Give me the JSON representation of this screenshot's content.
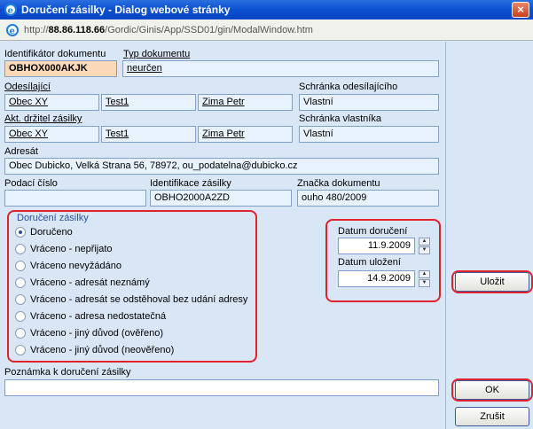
{
  "window": {
    "title": "Doručení zásilky - Dialog webové stránky",
    "close_label": "×"
  },
  "address": {
    "prefix": "http://",
    "host": "88.86.118.66",
    "path": "/Gordic/Ginis/App/SSD01/gin/ModalWindow.htm"
  },
  "fields": {
    "identifikator_label": "Identifikátor dokumentu",
    "identifikator_value": "OBHOX000AKJK",
    "typ_label": "Typ dokumentu",
    "typ_value": "neurčen",
    "odesilajici_label": "Odesílající",
    "odesilajici_values": [
      "Obec XY",
      "Test1",
      "Zima Petr"
    ],
    "schranka_odes_label": "Schránka odesílajícího",
    "schranka_odes_value": "Vlastní",
    "drzitel_label": "Akt. držitel zásilky",
    "drzitel_values": [
      "Obec XY",
      "Test1",
      "Zima Petr"
    ],
    "schranka_vlast_label": "Schránka vlastníka",
    "schranka_vlast_value": "Vlastní",
    "adresat_label": "Adresát",
    "adresat_value": "Obec Dubicko,  Velká Strana 56,  78972, ou_podatelna@dubicko.cz",
    "podaci_label": "Podací číslo",
    "podaci_value": "",
    "ident_zasilky_label": "Identifikace zásilky",
    "ident_zasilky_value": "OBHO2000A2ZD",
    "znacka_label": "Značka dokumentu",
    "znacka_value": "ouho 480/2009"
  },
  "delivery": {
    "group_title": "Doručení zásilky",
    "selected": 0,
    "options": [
      "Doručeno",
      "Vráceno - nepřijato",
      "Vráceno nevyžádáno",
      "Vráceno - adresát neznámý",
      "Vráceno - adresát se odstěhoval bez udání adresy",
      "Vráceno - adresa nedostatečná",
      "Vráceno - jiný důvod (ověřeno)",
      "Vráceno - jiný důvod (neověřeno)"
    ]
  },
  "dates": {
    "doruceni_label": "Datum doručení",
    "doruceni_value": "11.9.2009",
    "ulozeni_label": "Datum uložení",
    "ulozeni_value": "14.9.2009"
  },
  "note": {
    "label": "Poznámka k doručení zásilky",
    "value": ""
  },
  "buttons": {
    "ulozit": "Uložit",
    "ok": "OK",
    "zrusit": "Zrušit"
  },
  "spin": {
    "up": "▲",
    "down": "▼"
  },
  "colors": {
    "highlight": "#e0222f",
    "titlebar": "#0a4fd0"
  }
}
